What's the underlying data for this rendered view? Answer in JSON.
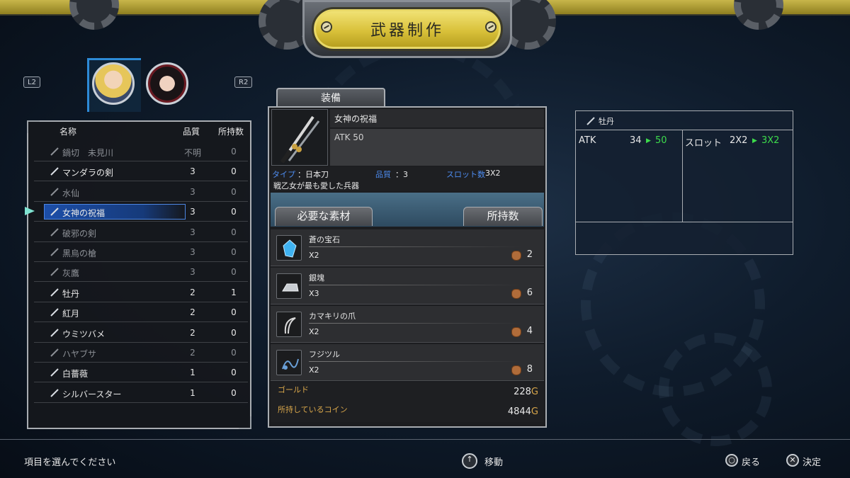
{
  "title": "武器制作",
  "shoulder": {
    "left": "L2",
    "right": "R2"
  },
  "list": {
    "headers": {
      "name": "名称",
      "quality": "品質",
      "owned": "所持数"
    },
    "rows": [
      {
        "name": "鍋切　未見川",
        "quality": "不明",
        "owned": "0",
        "dim": true
      },
      {
        "name": "マンダラの剣",
        "quality": "3",
        "owned": "0",
        "dim": false
      },
      {
        "name": "水仙",
        "quality": "3",
        "owned": "0",
        "dim": true
      },
      {
        "name": "女神の祝福",
        "quality": "3",
        "owned": "0",
        "dim": false,
        "selected": true
      },
      {
        "name": "破邪の剣",
        "quality": "3",
        "owned": "0",
        "dim": true
      },
      {
        "name": "黒烏の槍",
        "quality": "3",
        "owned": "0",
        "dim": true
      },
      {
        "name": "灰鷹",
        "quality": "3",
        "owned": "0",
        "dim": true
      },
      {
        "name": "牡丹",
        "quality": "2",
        "owned": "1",
        "dim": false
      },
      {
        "name": "紅月",
        "quality": "2",
        "owned": "0",
        "dim": false
      },
      {
        "name": "ウミツバメ",
        "quality": "2",
        "owned": "0",
        "dim": false
      },
      {
        "name": "ハヤブサ",
        "quality": "2",
        "owned": "0",
        "dim": true
      },
      {
        "name": "白薔薇",
        "quality": "1",
        "owned": "0",
        "dim": false
      },
      {
        "name": "シルバースター",
        "quality": "1",
        "owned": "0",
        "dim": false
      }
    ]
  },
  "equip": {
    "tab": "装備",
    "name": "女神の祝福",
    "atk": "ATK 50",
    "type_label": "タイプ",
    "type_value": "：日本刀",
    "quality_label": "品質",
    "quality_value": "：3",
    "slot_label": "スロット数",
    "slot_value": "3X2",
    "description": "戦乙女が最も愛した兵器"
  },
  "materials": {
    "required_label": "必要な素材",
    "owned_label": "所持数",
    "items": [
      {
        "name": "蒼の宝石",
        "qty": "X2",
        "owned": "2",
        "icon": "blue-gem-icon"
      },
      {
        "name": "銀塊",
        "qty": "X3",
        "owned": "6",
        "icon": "silver-ingot-icon"
      },
      {
        "name": "カマキリの爪",
        "qty": "X2",
        "owned": "4",
        "icon": "claw-icon"
      },
      {
        "name": "フジツル",
        "qty": "X2",
        "owned": "8",
        "icon": "vine-icon"
      }
    ]
  },
  "money": {
    "gold_label": "ゴールド",
    "gold_value": "228",
    "coin_label": "所持しているコイン",
    "coin_value": "4844",
    "unit": "G"
  },
  "compare": {
    "item_name": "牡丹",
    "atk_label": "ATK",
    "atk_from": "34",
    "atk_to": "50",
    "slot_label": "スロット",
    "slot_from": "2X2",
    "slot_to": "3X2"
  },
  "footer": {
    "prompt": "項目を選んでください",
    "move": "移動",
    "back": "戻る",
    "confirm": "決定"
  },
  "colors": {
    "accent_blue": "#1c4ea8",
    "stat_up": "#3ddc4b",
    "gold": "#d8a64a",
    "title_plate": "#d9c13a"
  }
}
